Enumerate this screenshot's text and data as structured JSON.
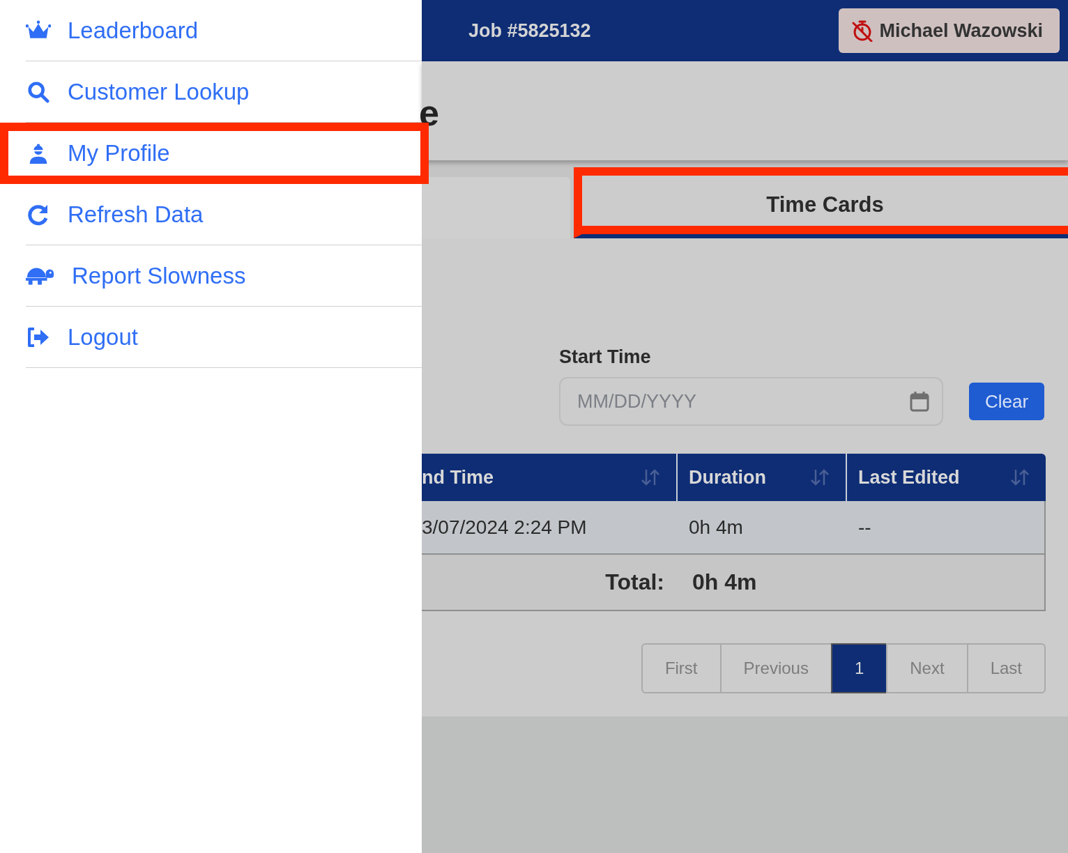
{
  "menu": [
    {
      "kind": "crown",
      "label": "Leaderboard",
      "highlighted": false
    },
    {
      "kind": "search",
      "label": "Customer Lookup",
      "highlighted": false
    },
    {
      "kind": "worker",
      "label": "My Profile",
      "highlighted": true
    },
    {
      "kind": "refresh",
      "label": "Refresh Data",
      "highlighted": false
    },
    {
      "kind": "turtle",
      "label": "Report Slowness",
      "highlighted": false
    },
    {
      "kind": "logout",
      "label": "Logout",
      "highlighted": false
    }
  ],
  "header": {
    "job": "Job #5825132",
    "user": "Michael Wazowski"
  },
  "page_title": "e",
  "tabs": [
    {
      "selected": false,
      "highlighted": false
    },
    {
      "label": "Time Cards",
      "selected": true,
      "highlighted": true
    }
  ],
  "filter": {
    "label": "Start Time",
    "placeholder": "MM/DD/YYYY",
    "clear_button": "Clear"
  },
  "table": {
    "columns": [
      "nd Time",
      "Duration",
      "Last Edited"
    ],
    "rows": [
      [
        "3/07/2024 2:24 PM",
        "0h 4m",
        "--"
      ]
    ],
    "total": {
      "label": "Total:",
      "value": "0h 4m"
    }
  },
  "pagination": [
    {
      "label": "First",
      "selected": false
    },
    {
      "label": "Previous",
      "selected": false
    },
    {
      "label": "1",
      "selected": true
    },
    {
      "label": "Next",
      "selected": false
    },
    {
      "label": "Last",
      "selected": false
    }
  ]
}
